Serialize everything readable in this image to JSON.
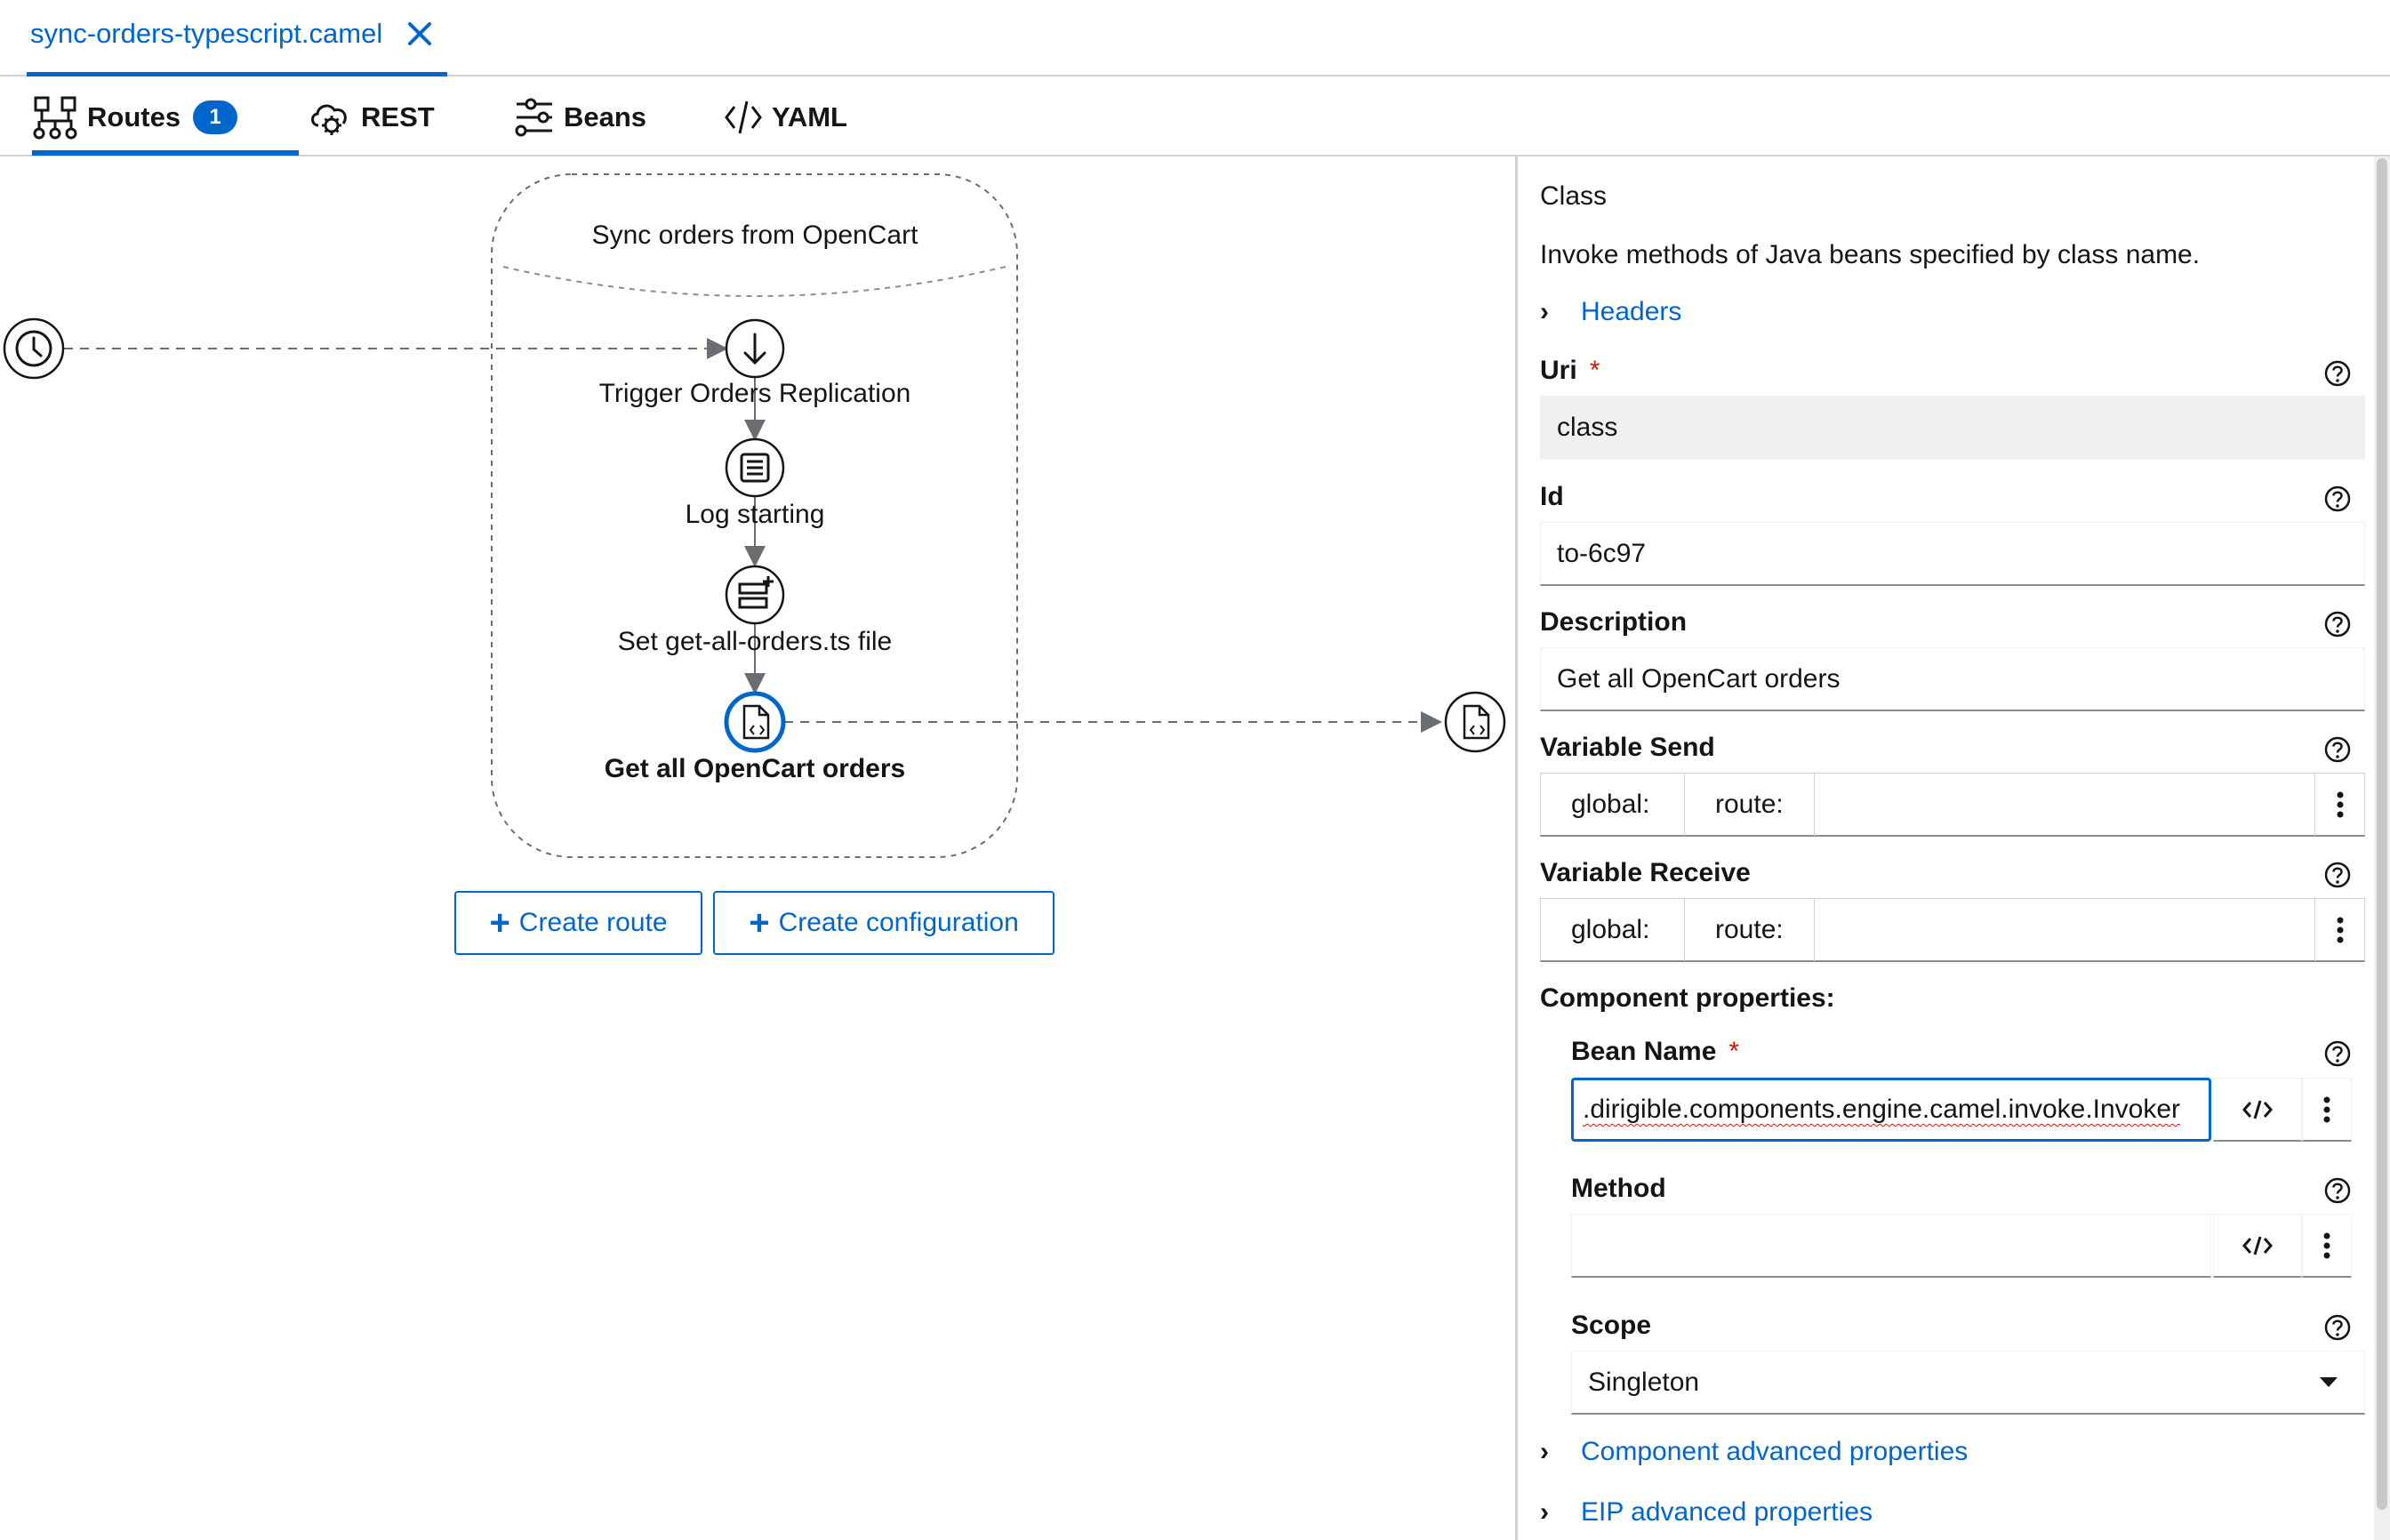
{
  "file_tab": {
    "name": "sync-orders-typescript.camel",
    "close_icon": "close-icon"
  },
  "view_tabs": [
    {
      "label": "Routes",
      "badge": "1",
      "icon": "routes-icon",
      "active": true
    },
    {
      "label": "REST",
      "icon": "cloud-gear-icon"
    },
    {
      "label": "Beans",
      "icon": "beans-sliders-icon"
    },
    {
      "label": "YAML",
      "icon": "code-icon"
    }
  ],
  "canvas": {
    "route_title": "Sync orders from OpenCart",
    "nodes": [
      {
        "label": "Trigger Orders Replication",
        "icon": "arrow-down-icon"
      },
      {
        "label": "Log starting",
        "icon": "log-icon"
      },
      {
        "label": "Set get-all-orders.ts file",
        "icon": "set-header-icon"
      },
      {
        "label": "Get all OpenCart orders",
        "icon": "class-file-icon",
        "selected": true
      }
    ],
    "source_icon": "clock-icon",
    "target_icon": "class-file-icon",
    "buttons": {
      "create_route": "Create route",
      "create_configuration": "Create configuration"
    }
  },
  "panel": {
    "title": "Class",
    "description": "Invoke methods of Java beans specified by class name.",
    "headers_link": "Headers",
    "uri": {
      "label": "Uri",
      "value": "class"
    },
    "id": {
      "label": "Id",
      "value": "to-6c97"
    },
    "description_field": {
      "label": "Description",
      "value": "Get all OpenCart orders"
    },
    "variable_send": {
      "label": "Variable Send",
      "global": "global:",
      "route": "route:"
    },
    "variable_receive": {
      "label": "Variable Receive",
      "global": "global:",
      "route": "route:"
    },
    "component_properties": {
      "label": "Component properties:",
      "bean_name": {
        "label": "Bean Name",
        "value": ".dirigible.components.engine.camel.invoke.Invoker"
      },
      "method": {
        "label": "Method",
        "value": ""
      },
      "scope": {
        "label": "Scope",
        "value": "Singleton"
      }
    },
    "component_advanced_link": "Component advanced properties",
    "eip_advanced_link": "EIP advanced properties"
  },
  "colors": {
    "accent": "#0066cc",
    "required": "#c9190b",
    "border": "#d2d2d2"
  }
}
